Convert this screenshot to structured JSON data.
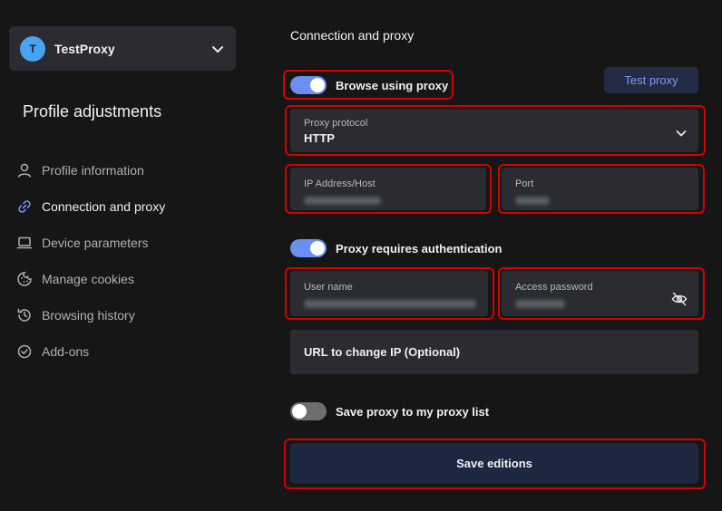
{
  "profile": {
    "avatar_letter": "T",
    "name": "TestProxy"
  },
  "sidebar": {
    "title": "Profile adjustments",
    "items": [
      {
        "label": "Profile information",
        "icon": "user-icon"
      },
      {
        "label": "Connection and proxy",
        "icon": "link-icon",
        "active": true
      },
      {
        "label": "Device parameters",
        "icon": "laptop-icon"
      },
      {
        "label": "Manage cookies",
        "icon": "cookie-icon"
      },
      {
        "label": "Browsing history",
        "icon": "history-icon"
      },
      {
        "label": "Add-ons",
        "icon": "check-circle-icon"
      }
    ]
  },
  "main": {
    "section_title": "Connection and proxy",
    "browse_proxy": {
      "label": "Browse using proxy",
      "on": true
    },
    "test_proxy_label": "Test proxy",
    "protocol": {
      "label": "Proxy protocol",
      "value": "HTTP"
    },
    "ip": {
      "label": "IP Address/Host"
    },
    "port": {
      "label": "Port"
    },
    "auth": {
      "label": "Proxy requires authentication",
      "on": true
    },
    "username": {
      "label": "User name"
    },
    "password": {
      "label": "Access password"
    },
    "url_change_ip": {
      "placeholder": "URL to change IP (Optional)"
    },
    "save_list": {
      "label": "Save proxy to my proxy list",
      "on": false
    },
    "save_label": "Save editions"
  },
  "colors": {
    "accent": "#6b8ff0",
    "highlight": "#d40000",
    "field_bg": "#2a2c31"
  }
}
